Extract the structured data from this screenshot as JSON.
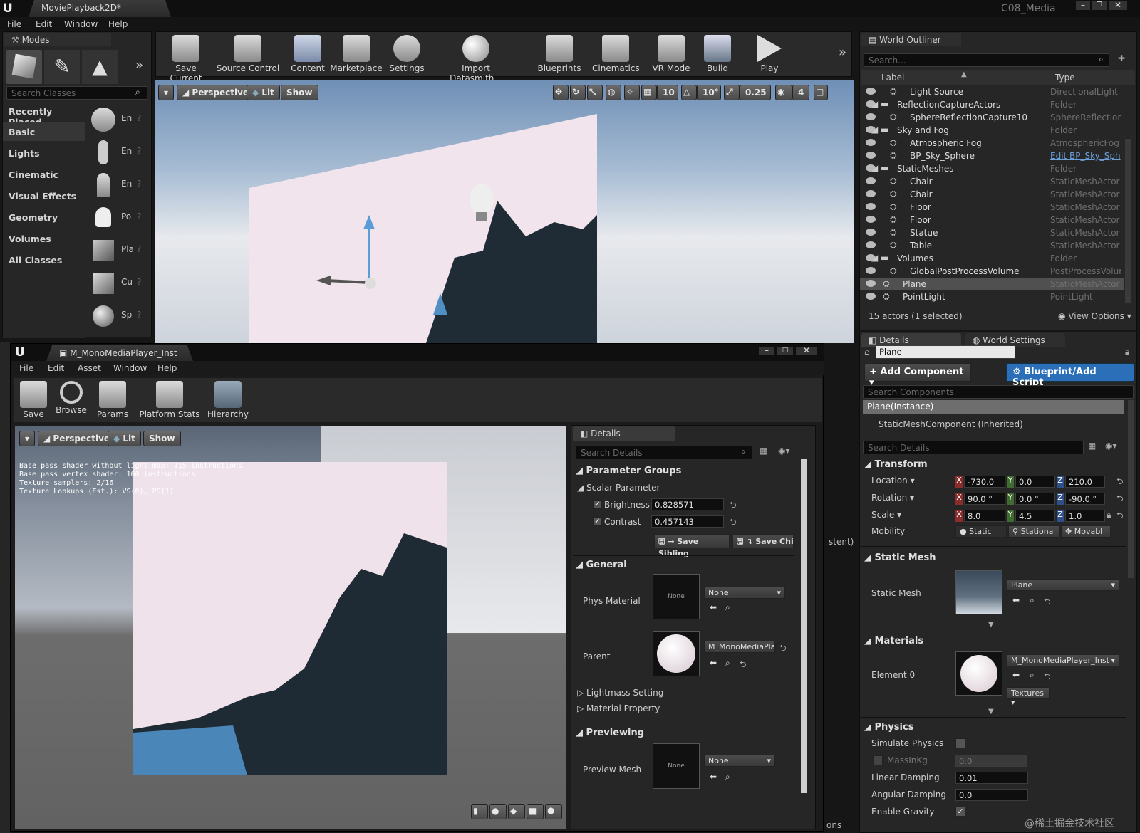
{
  "main": {
    "tab_title": "MoviePlayback2D*",
    "project_name": "C08_Media",
    "menu": [
      "File",
      "Edit",
      "Window",
      "Help"
    ]
  },
  "toolbar": {
    "buttons": [
      "Save Current",
      "Source Control",
      "Content",
      "Marketplace",
      "Settings",
      "Import Datasmith...",
      "Blueprints",
      "Cinematics",
      "VR Mode",
      "Build",
      "Play"
    ]
  },
  "modes": {
    "tab": "Modes",
    "search_placeholder": "Search Classes",
    "categories": [
      "Recently Placed",
      "Basic",
      "Lights",
      "Cinematic",
      "Visual Effects",
      "Geometry",
      "Volumes",
      "All Classes"
    ],
    "items": [
      "En",
      "En",
      "En",
      "Po",
      "Pla",
      "Cu",
      "Sp"
    ]
  },
  "viewport": {
    "view_mode": "Perspective",
    "lit": "Lit",
    "show": "Show",
    "grid_snap": "10",
    "rot_snap": "10°",
    "scale_snap": "0.25",
    "cam_speed": "4"
  },
  "outliner": {
    "tab": "World Outliner",
    "search_placeholder": "Search...",
    "col_label": "Label",
    "col_type": "Type",
    "rows": [
      {
        "label": "Light Source",
        "type": "DirectionalLight",
        "indent": 1
      },
      {
        "label": "ReflectionCaptureActors",
        "type": "Folder",
        "indent": 0
      },
      {
        "label": "SphereReflectionCapture10",
        "type": "SphereReflectionC",
        "indent": 1
      },
      {
        "label": "Sky and Fog",
        "type": "Folder",
        "indent": 0
      },
      {
        "label": "Atmospheric Fog",
        "type": "AtmosphericFog",
        "indent": 1
      },
      {
        "label": "BP_Sky_Sphere",
        "type": "Edit BP_Sky_Sph",
        "indent": 1
      },
      {
        "label": "StaticMeshes",
        "type": "Folder",
        "indent": 0
      },
      {
        "label": "Chair",
        "type": "StaticMeshActor",
        "indent": 1
      },
      {
        "label": "Chair",
        "type": "StaticMeshActor",
        "indent": 1
      },
      {
        "label": "Floor",
        "type": "StaticMeshActor",
        "indent": 1
      },
      {
        "label": "Floor",
        "type": "StaticMeshActor",
        "indent": 1
      },
      {
        "label": "Statue",
        "type": "StaticMeshActor",
        "indent": 1
      },
      {
        "label": "Table",
        "type": "StaticMeshActor",
        "indent": 1
      },
      {
        "label": "Volumes",
        "type": "Folder",
        "indent": 0
      },
      {
        "label": "GlobalPostProcessVolume",
        "type": "PostProcessVolum",
        "indent": 1
      },
      {
        "label": "Plane",
        "type": "StaticMeshActor",
        "indent": 0
      },
      {
        "label": "PointLight",
        "type": "PointLight",
        "indent": 0
      }
    ],
    "status": "15 actors (1 selected)",
    "view_options": "View Options"
  },
  "details": {
    "tab": "Details",
    "tab2": "World Settings",
    "name": "Plane",
    "add_component": "Add Component",
    "blueprint": "Blueprint/Add Script",
    "search_components": "Search Components",
    "component_root": "Plane(Instance)",
    "component_child": "StaticMeshComponent (Inherited)",
    "search_details": "Search Details",
    "transform": "Transform",
    "location": {
      "label": "Location",
      "x": "-730.0",
      "y": "0.0",
      "z": "210.0"
    },
    "rotation": {
      "label": "Rotation",
      "x": "90.0 °",
      "y": "0.0 °",
      "z": "-90.0 °"
    },
    "scale": {
      "label": "Scale",
      "x": "8.0",
      "y": "4.5",
      "z": "1.0"
    },
    "mobility": {
      "label": "Mobility",
      "opts": [
        "Static",
        "Stationa",
        "Movabl"
      ]
    },
    "static_mesh_section": "Static Mesh",
    "static_mesh_label": "Static Mesh",
    "static_mesh_value": "Plane",
    "materials_section": "Materials",
    "element0": "Element 0",
    "material_value": "M_MonoMediaPlayer_Inst",
    "textures": "Textures",
    "physics_section": "Physics",
    "simulate": "Simulate Physics",
    "mass": "MassInKg",
    "mass_value": "0.0",
    "linear": "Linear Damping",
    "linear_value": "0.01",
    "angular": "Angular Damping",
    "angular_value": "0.0",
    "gravity": "Enable Gravity"
  },
  "mat_editor": {
    "tab": "M_MonoMediaPlayer_Inst",
    "menu": [
      "File",
      "Edit",
      "Asset",
      "Window",
      "Help"
    ],
    "toolbar": [
      "Save",
      "Browse",
      "Params",
      "Platform Stats",
      "Hierarchy"
    ],
    "stats": [
      "Base pass shader without light map: 115 instructions",
      "Base pass vertex shader: 160 instructions",
      "Texture samplers: 2/16",
      "Texture Lookups (Est.): VS(0), PS(1)"
    ],
    "details_tab": "Details",
    "search_details": "Search Details",
    "param_groups": "Parameter Groups",
    "scalar": "Scalar Parameter",
    "brightness": "Brightness",
    "brightness_value": "0.828571",
    "contrast": "Contrast",
    "contrast_value": "0.457143",
    "save_sibling": "Save Sibling",
    "save_child": "Save Child",
    "general": "General",
    "phys_material": "Phys Material",
    "none": "None",
    "parent": "Parent",
    "parent_value": "M_MonoMediaPla",
    "lightmass": "Lightmass Setting",
    "material_property": "Material Property",
    "previewing": "Previewing",
    "preview_mesh": "Preview Mesh"
  },
  "background_fragments": {
    "stent": "stent)",
    "ons": "ons"
  },
  "watermark": "@稀土掘金技术社区"
}
